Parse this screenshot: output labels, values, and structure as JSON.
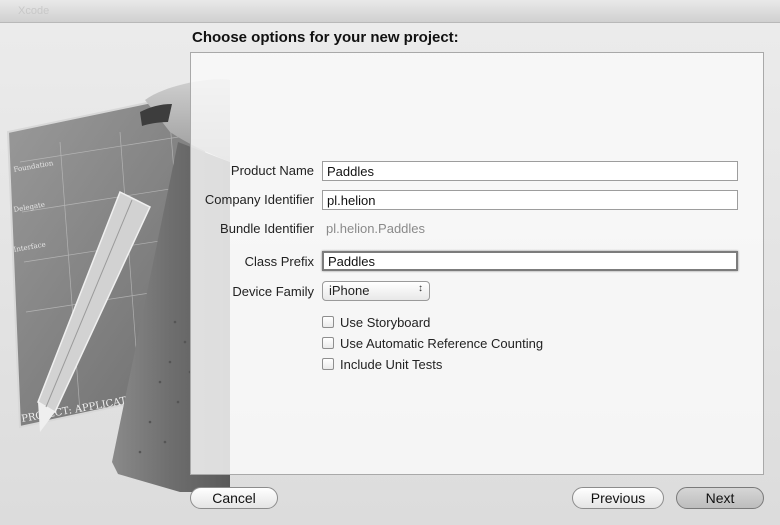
{
  "window": {
    "title": "Xcode"
  },
  "heading": "Choose options for your new project:",
  "artwork": {
    "blueprint_stamp": "PROJECT: APPLICATION.APP",
    "blueprint_notes": [
      "Foundation",
      "Delegate",
      "Interface"
    ]
  },
  "form": {
    "product_name_label": "Product Name",
    "product_name_value": "Paddles",
    "company_identifier_label": "Company Identifier",
    "company_identifier_value": "pl.helion",
    "bundle_identifier_label": "Bundle Identifier",
    "bundle_identifier_value": "pl.helion.Paddles",
    "class_prefix_label": "Class Prefix",
    "class_prefix_value": "Paddles",
    "device_family_label": "Device Family",
    "device_family_value": "iPhone",
    "checkboxes": [
      {
        "label": "Use Storyboard",
        "checked": false
      },
      {
        "label": "Use Automatic Reference Counting",
        "checked": false
      },
      {
        "label": "Include Unit Tests",
        "checked": false
      }
    ]
  },
  "buttons": {
    "cancel": "Cancel",
    "previous": "Previous",
    "next": "Next"
  }
}
